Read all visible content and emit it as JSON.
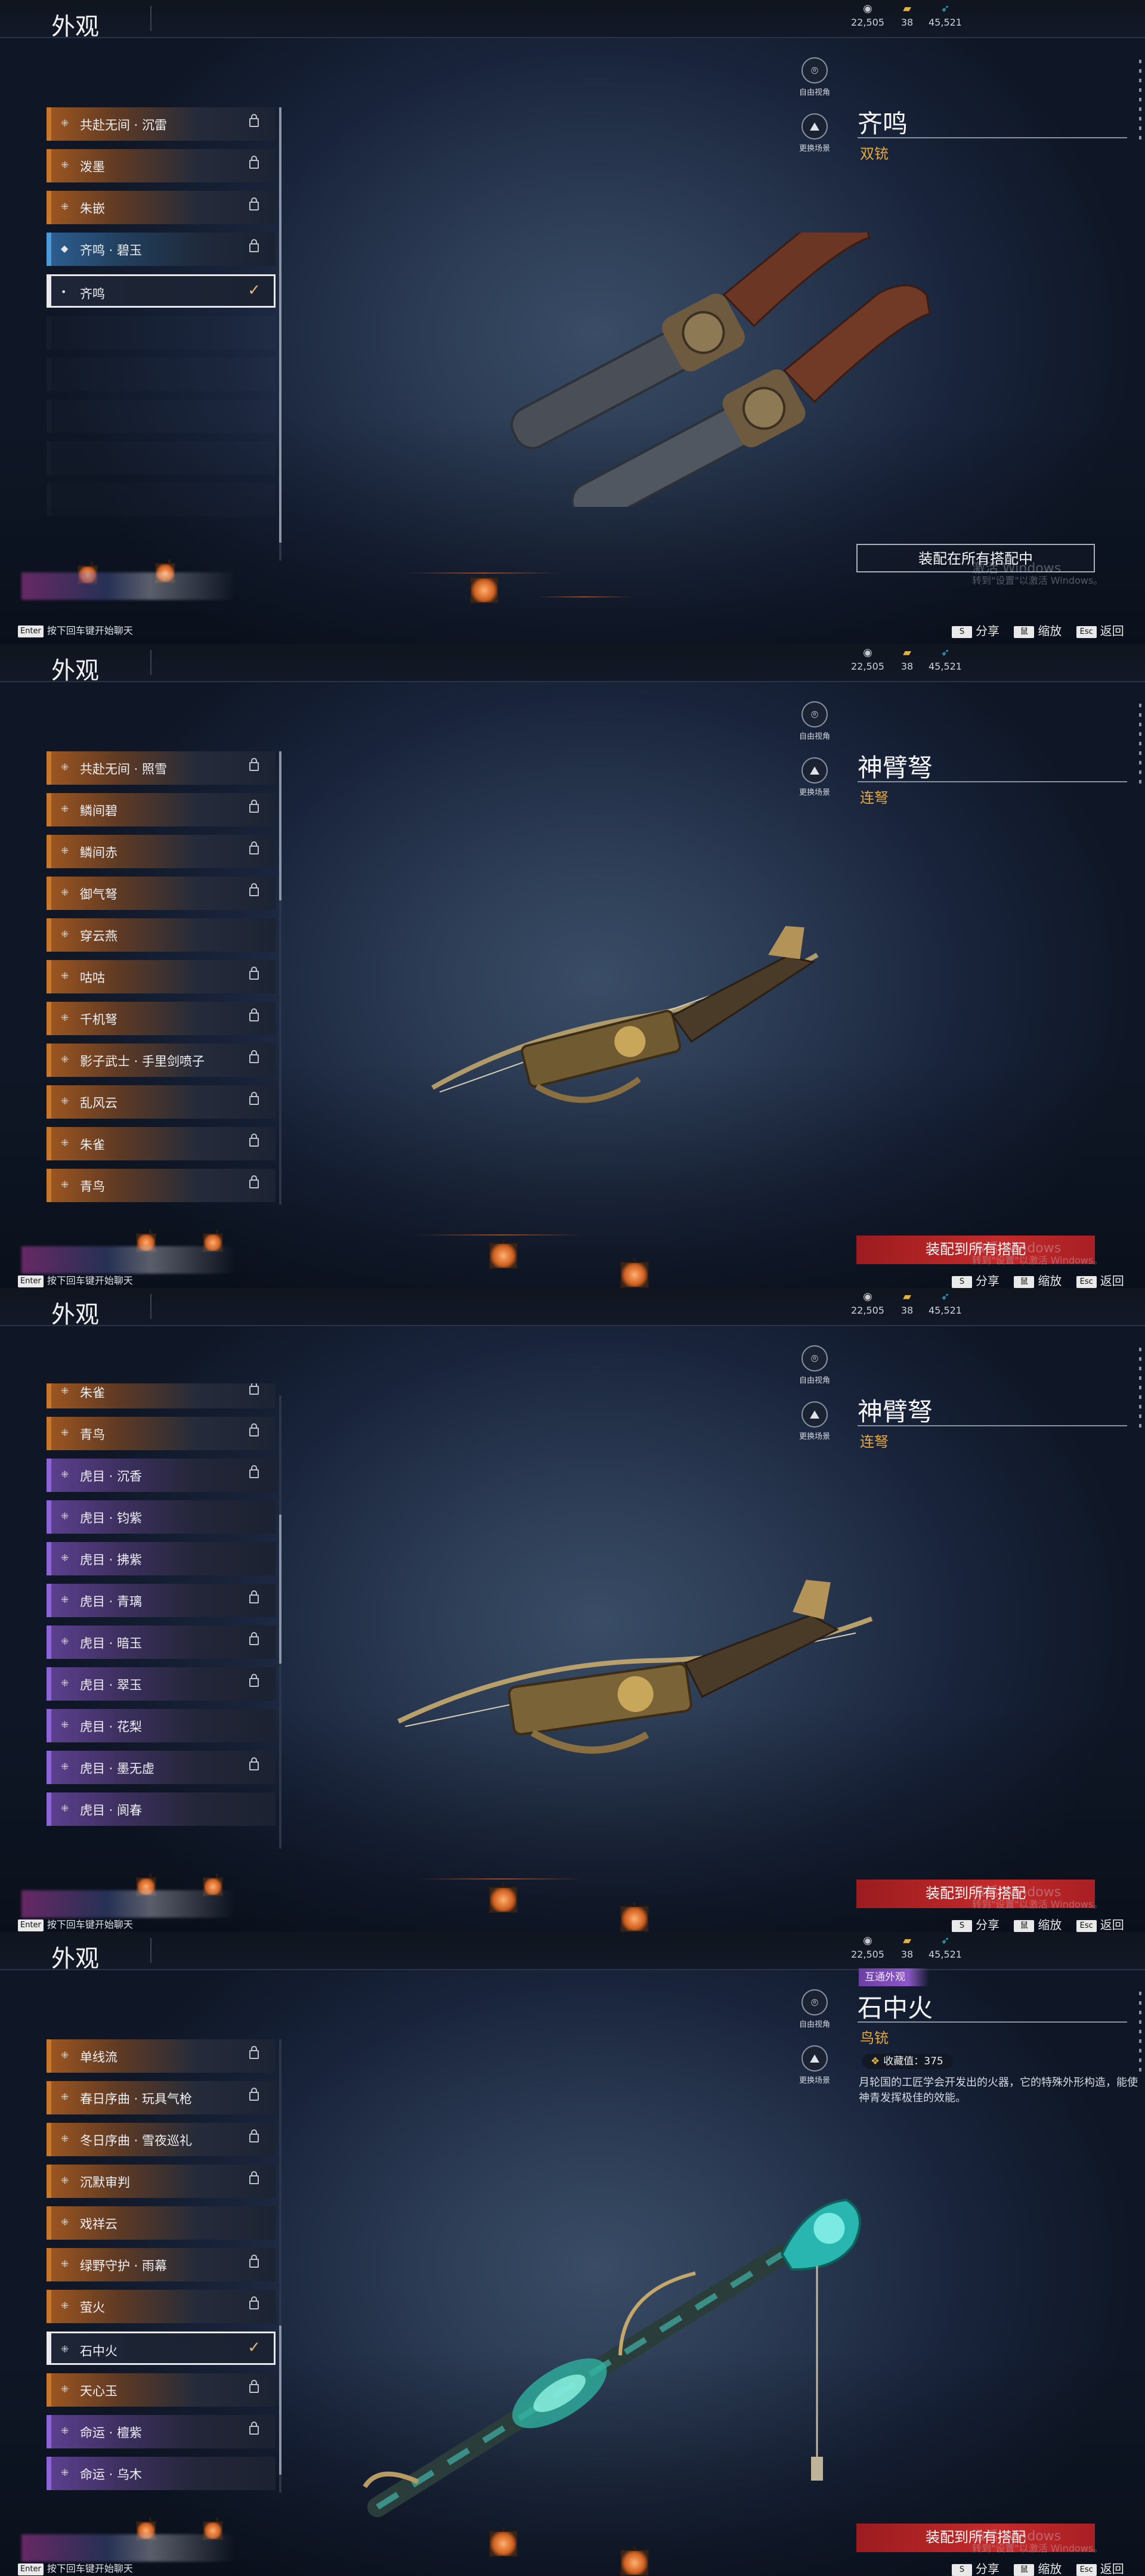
{
  "screen": {
    "title": "外观",
    "currencies": [
      {
        "icon": "eye-icon",
        "value": "22,505"
      },
      {
        "icon": "gold-chest-icon",
        "value": "38"
      },
      {
        "icon": "feather-icon",
        "value": "45,521"
      }
    ],
    "side_buttons": {
      "free_view": "自由视角",
      "change_scene": "更换场景"
    },
    "chat_hint": "按下回车键开始聊天",
    "enter_key": "Enter",
    "hints": [
      {
        "key": "S",
        "label": "分享"
      },
      {
        "key": "鼠",
        "label": "缩放"
      },
      {
        "key": "Esc",
        "label": "返回"
      }
    ],
    "watermark_line1": "激活 Windows",
    "watermark_line2": "转到\"设置\"以激活 Windows。",
    "accent_colors": {
      "type_text": "#e5a93c",
      "equip_red": "#c42a2a",
      "orange_rarity": "#c9772a",
      "purple_rarity": "#8c63d8",
      "blue_rarity": "#4a9bd6"
    }
  },
  "panels": [
    {
      "weapon_name": "齐鸣",
      "weapon_type": "双铳",
      "equip_label": "装配在所有搭配中",
      "equip_style": "outline",
      "items": [
        {
          "label": "共赴无间 · 沉雷",
          "rarity": "orange",
          "icon": "cross-icon",
          "state": "locked"
        },
        {
          "label": "泼墨",
          "rarity": "orange",
          "icon": "cross-icon",
          "state": "locked"
        },
        {
          "label": "朱嵌",
          "rarity": "orange",
          "icon": "cross-icon",
          "state": "locked"
        },
        {
          "label": "齐鸣 · 碧玉",
          "rarity": "blue",
          "icon": "diamond-icon",
          "state": "locked"
        },
        {
          "label": "齐鸣",
          "rarity": "none",
          "icon": "dot-icon",
          "state": "selected"
        }
      ]
    },
    {
      "weapon_name": "神臂弩",
      "weapon_type": "连弩",
      "equip_label": "装配到所有搭配",
      "equip_style": "red",
      "items": [
        {
          "label": "共赴无间 · 照雪",
          "rarity": "orange",
          "icon": "cross-icon",
          "state": "locked"
        },
        {
          "label": "鳞间碧",
          "rarity": "orange",
          "icon": "cross-icon",
          "state": "locked"
        },
        {
          "label": "鳞间赤",
          "rarity": "orange",
          "icon": "cross-icon",
          "state": "locked"
        },
        {
          "label": "御气弩",
          "rarity": "orange",
          "icon": "cross-icon",
          "state": "locked"
        },
        {
          "label": "穿云燕",
          "rarity": "orange",
          "icon": "cross-icon",
          "state": "none"
        },
        {
          "label": "咕咕",
          "rarity": "orange",
          "icon": "cross-icon",
          "state": "locked"
        },
        {
          "label": "千机弩",
          "rarity": "orange",
          "icon": "cross-icon",
          "state": "locked"
        },
        {
          "label": "影子武士 · 手里剑喷子",
          "rarity": "orange",
          "icon": "cross-icon",
          "state": "locked"
        },
        {
          "label": "乱风云",
          "rarity": "orange",
          "icon": "cross-icon",
          "state": "locked"
        },
        {
          "label": "朱雀",
          "rarity": "orange",
          "icon": "cross-icon",
          "state": "locked"
        },
        {
          "label": "青鸟",
          "rarity": "orange",
          "icon": "cross-icon",
          "state": "locked"
        }
      ]
    },
    {
      "weapon_name": "神臂弩",
      "weapon_type": "连弩",
      "equip_label": "装配到所有搭配",
      "equip_style": "red",
      "items": [
        {
          "label": "朱雀",
          "rarity": "orange",
          "icon": "cross-icon",
          "state": "locked"
        },
        {
          "label": "青鸟",
          "rarity": "orange",
          "icon": "cross-icon",
          "state": "locked"
        },
        {
          "label": "虎目 · 沉香",
          "rarity": "purple",
          "icon": "cross-icon",
          "state": "locked"
        },
        {
          "label": "虎目 · 钧紫",
          "rarity": "purple",
          "icon": "cross-icon",
          "state": "none"
        },
        {
          "label": "虎目 · 拂紫",
          "rarity": "purple",
          "icon": "cross-icon",
          "state": "none"
        },
        {
          "label": "虎目 · 青璃",
          "rarity": "purple",
          "icon": "cross-icon",
          "state": "locked"
        },
        {
          "label": "虎目 · 暗玉",
          "rarity": "purple",
          "icon": "cross-icon",
          "state": "locked"
        },
        {
          "label": "虎目 · 翠玉",
          "rarity": "purple",
          "icon": "cross-icon",
          "state": "locked"
        },
        {
          "label": "虎目 · 花梨",
          "rarity": "purple",
          "icon": "cross-icon",
          "state": "none"
        },
        {
          "label": "虎目 · 墨无虚",
          "rarity": "purple",
          "icon": "cross-icon",
          "state": "locked"
        },
        {
          "label": "虎目 · 阆春",
          "rarity": "purple",
          "icon": "cross-icon",
          "state": "none"
        }
      ]
    },
    {
      "weapon_name": "石中火",
      "weapon_type": "鸟铳",
      "tag": "互通外观",
      "collect_label": "收藏值：375",
      "description": "月轮国的工匠学会开发出的火器，它的特殊外形构造，能使神青发挥极佳的效能。",
      "equip_label": "装配到所有搭配",
      "equip_style": "red",
      "items": [
        {
          "label": "单线流",
          "rarity": "orange",
          "icon": "cross-icon",
          "state": "locked"
        },
        {
          "label": "春日序曲 · 玩具气枪",
          "rarity": "orange",
          "icon": "cross-icon",
          "state": "locked"
        },
        {
          "label": "冬日序曲 · 雪夜巡礼",
          "rarity": "orange",
          "icon": "cross-icon",
          "state": "locked"
        },
        {
          "label": "沉默审判",
          "rarity": "orange",
          "icon": "cross-icon",
          "state": "locked"
        },
        {
          "label": "戏祥云",
          "rarity": "orange",
          "icon": "cross-icon",
          "state": "none"
        },
        {
          "label": "绿野守护 · 雨幕",
          "rarity": "orange",
          "icon": "cross-icon",
          "state": "locked"
        },
        {
          "label": "萤火",
          "rarity": "orange",
          "icon": "cross-icon",
          "state": "locked"
        },
        {
          "label": "石中火",
          "rarity": "none",
          "icon": "cross-icon",
          "state": "selected"
        },
        {
          "label": "天心玉",
          "rarity": "orange",
          "icon": "cross-icon",
          "state": "locked"
        },
        {
          "label": "命运 · 檀紫",
          "rarity": "purple",
          "icon": "cross-icon",
          "state": "locked"
        },
        {
          "label": "命运 · 乌木",
          "rarity": "purple",
          "icon": "cross-icon",
          "state": "none"
        }
      ]
    }
  ]
}
